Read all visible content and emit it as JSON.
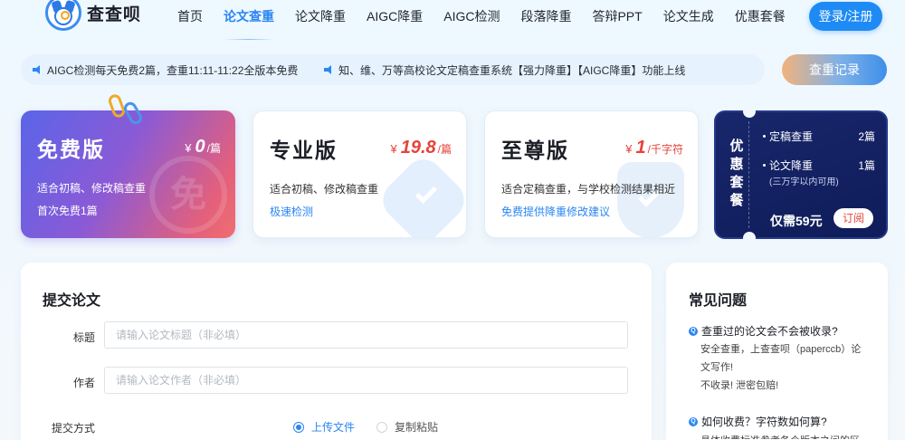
{
  "header": {
    "logo_text": "查查呗",
    "nav": [
      {
        "label": "首页",
        "active": false
      },
      {
        "label": "论文查重",
        "active": true
      },
      {
        "label": "论文降重",
        "active": false
      },
      {
        "label": "AIGC降重",
        "active": false
      },
      {
        "label": "AIGC检测",
        "active": false
      },
      {
        "label": "段落降重",
        "active": false
      },
      {
        "label": "答辩PPT",
        "active": false
      },
      {
        "label": "论文生成",
        "active": false
      },
      {
        "label": "优惠套餐",
        "active": false
      }
    ],
    "login_label": "登录/注册"
  },
  "notice": {
    "msg1": "AIGC检测每天免费2篇，查重11:11-11:22全版本免费",
    "msg2": "知、维、万等高校论文定稿查重系统【强力降重】【AIGC降重】功能上线",
    "record_label": "查重记录"
  },
  "plans": {
    "free": {
      "title": "免费版",
      "currency": "¥",
      "price": "0",
      "unit": "/篇",
      "desc": "适合初稿、修改稿查重",
      "sub": "首次免费1篇",
      "watermark": "免"
    },
    "pro": {
      "title": "专业版",
      "currency": "¥",
      "price": "19.8",
      "unit": "/篇",
      "desc": "适合初稿、修改稿查重",
      "sub": "极速检测"
    },
    "supreme": {
      "title": "至尊版",
      "currency": "¥",
      "price": "1",
      "unit": "/千字符",
      "desc": "适合定稿查重，与学校检测结果相近",
      "sub": "免费提供降重修改建议"
    }
  },
  "combo": {
    "title": "优惠套餐",
    "item1_label": "定稿查重",
    "item1_value": "2篇",
    "item2_label": "论文降重",
    "item2_value": "1篇",
    "item2_note": "(三万字以内可用)",
    "price_label": "仅需59元",
    "button_label": "订阅"
  },
  "submit": {
    "title": "提交论文",
    "title_label": "标题",
    "title_placeholder": "请输入论文标题（非必填）",
    "author_label": "作者",
    "author_placeholder": "请输入论文作者（非必填）",
    "method_label": "提交方式",
    "option_upload": "上传文件",
    "option_paste": "复制粘贴"
  },
  "faq": {
    "title": "常见问题",
    "q1": "查重过的论文会不会被收录?",
    "a1": "安全查重，上查查呗（paperccb）论文写作!",
    "a1b": "不收录! 泄密包赔!",
    "q2": "如何收费？字符数如何算?",
    "a2": "具体收费标准参考各个版本之间的区"
  },
  "colors": {
    "accent": "#2a86f2",
    "price_red": "#e5433b",
    "combo_bg": "#18276b"
  }
}
